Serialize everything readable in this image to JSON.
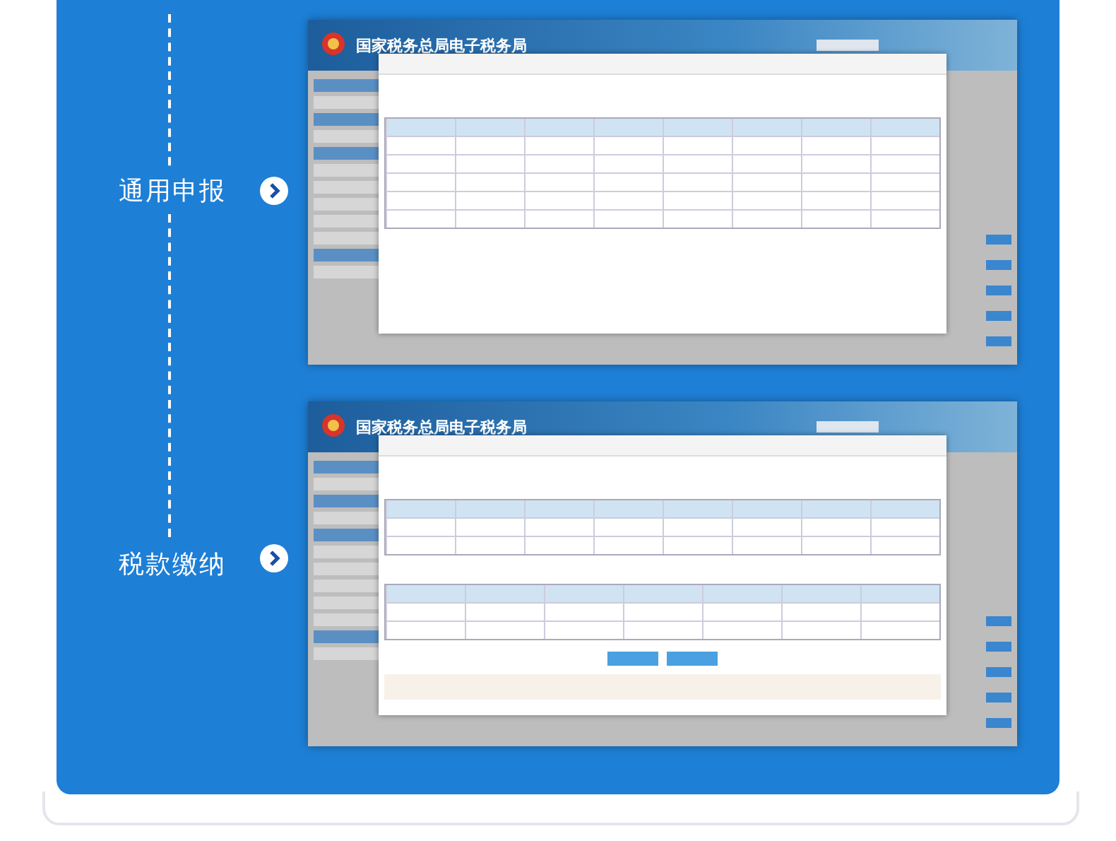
{
  "sections": [
    {
      "label": "通用申报",
      "screenshot": {
        "site_title": "国家税务总局电子税务局"
      }
    },
    {
      "label": "税款缴纳",
      "screenshot": {
        "site_title": "国家税务总局电子税务局"
      }
    }
  ]
}
